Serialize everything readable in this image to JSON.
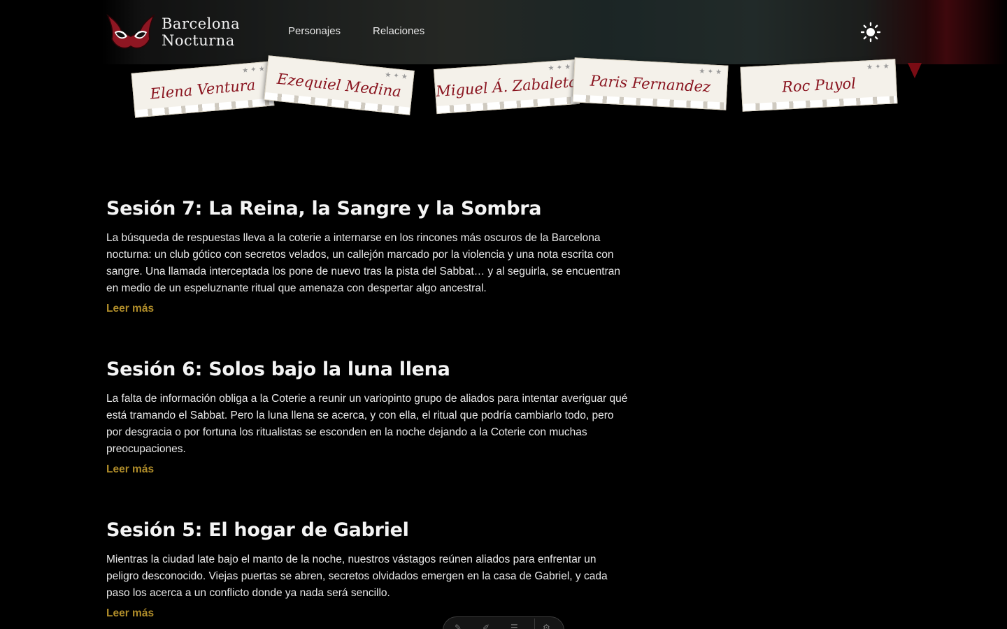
{
  "header": {
    "logo_line1": "Barcelona",
    "logo_line2": "Nocturna",
    "nav": [
      "Personajes",
      "Relaciones"
    ]
  },
  "characters": [
    "Elena Ventura",
    "Ezequiel Medina",
    "Miguel Á. Zabaleta",
    "Paris Fernandez",
    "Roc Puyol"
  ],
  "sessions": [
    {
      "title": "Sesión 7: La Reina, la Sangre y la Sombra",
      "text": "La búsqueda de respuestas lleva a la coterie a internarse en los rincones más oscuros de la Barcelona nocturna: un club gótico con secretos velados, un callejón marcado por la violencia y una nota escrita con sangre. Una llamada interceptada los pone de nuevo tras la pista del Sabbat… y al seguirla, se encuentran en medio de un espeluznante ritual que amenaza con despertar algo ancestral.",
      "link": "Leer más"
    },
    {
      "title": "Sesión 6: Solos bajo la luna llena",
      "text": "La falta de información obliga a la Coterie a reunir un variopinto grupo de aliados para intentar averiguar qué está tramando el Sabbat. Pero la luna llena se acerca, y con ella, el ritual que podría cambiarlo todo, pero por desgracia o por fortuna los ritualistas se esconden en la noche dejando a la Coterie con muchas preocupaciones.",
      "link": "Leer más"
    },
    {
      "title": "Sesión 5: El hogar de Gabriel",
      "text": "Mientras la ciudad late bajo el manto de la noche, nuestros vástagos reúnen aliados para enfrentar un peligro desconocido. Viejas puertas se abren, secretos olvidados emergen en la casa de Gabriel, y cada paso los acerca a un conflicto donde ya nada será sencillo.",
      "link": "Leer más"
    }
  ],
  "colors": {
    "background": "#000000",
    "accent_link": "#b08d2a",
    "card_name": "#8a1520"
  }
}
